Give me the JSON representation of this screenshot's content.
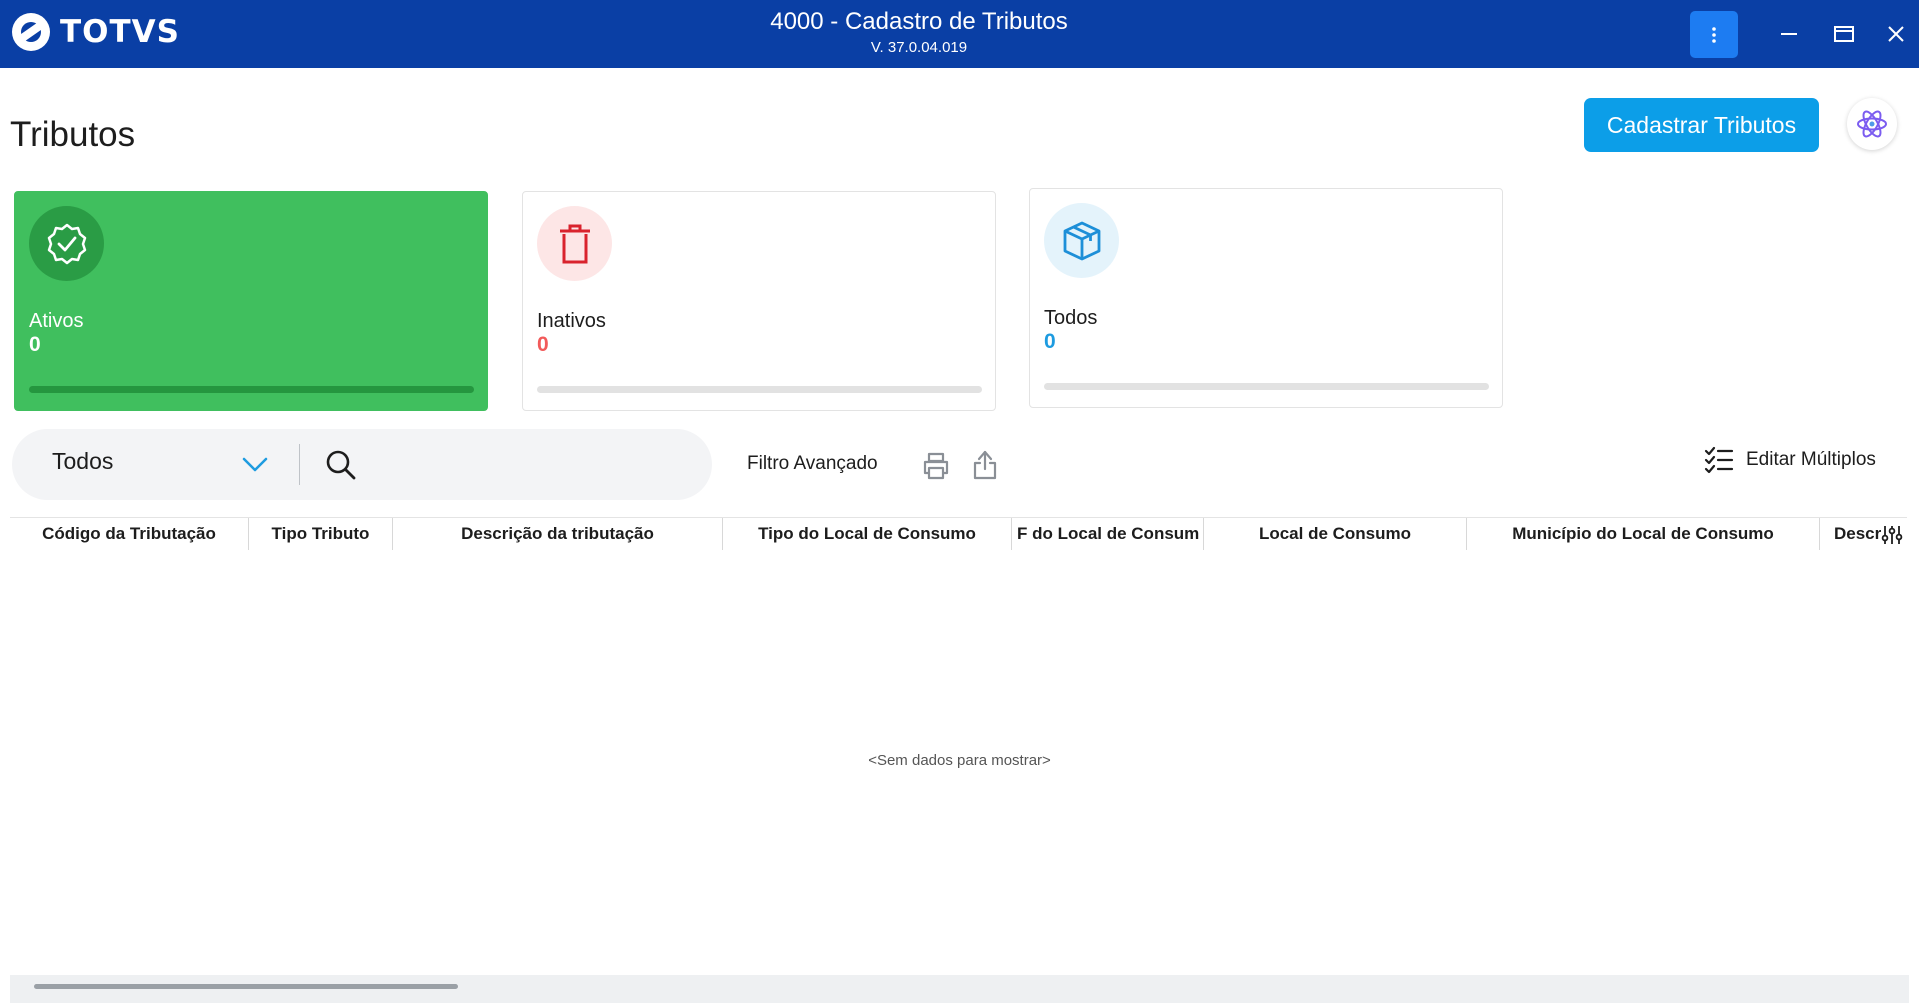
{
  "titlebar": {
    "brand": "TOTVS",
    "title": "4000 - Cadastro de Tributos",
    "version": "V. 37.0.04.019",
    "menu_glyph": "⋮",
    "bg_color": "#0a3fa5"
  },
  "page": {
    "title": "Tributos",
    "primary_action": "Cadastrar Tributos",
    "assistant_icon": "atom-icon"
  },
  "cards": [
    {
      "label": "Ativos",
      "count": "0",
      "icon": "check-badge-icon",
      "count_color": "#ffffff"
    },
    {
      "label": "Inativos",
      "count": "0",
      "icon": "trash-icon",
      "count_color": "#f25a5a"
    },
    {
      "label": "Todos",
      "count": "0",
      "icon": "box-icon",
      "count_color": "#1d9be0"
    }
  ],
  "filter": {
    "selected": "Todos",
    "search_value": "",
    "advanced_label": "Filtro Avançado",
    "multi_edit_label": "Editar Múltiplos"
  },
  "table": {
    "columns": [
      "Código da Tributação",
      "Tipo Tributo",
      "Descrição da tributação",
      "Tipo do Local de Consumo",
      "F do Local de Consum",
      "Local de Consumo",
      "Município do Local de Consumo",
      "Descr"
    ],
    "rows": [],
    "empty_message": "<Sem dados para mostrar>"
  }
}
